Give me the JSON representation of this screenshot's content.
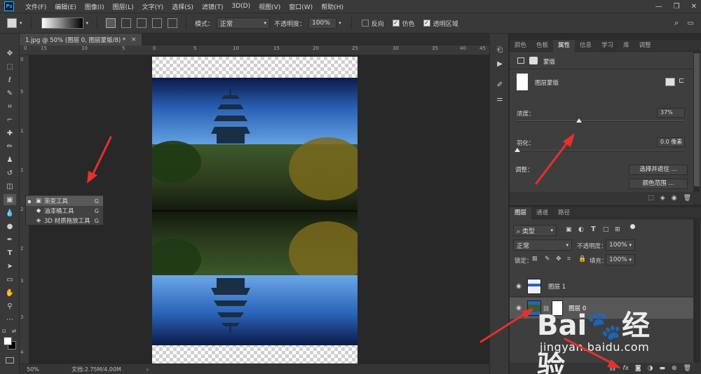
{
  "menubar": {
    "logo": "Ps",
    "items": [
      "文件(F)",
      "编辑(E)",
      "图像(I)",
      "图层(L)",
      "文字(Y)",
      "选择(S)",
      "滤镜(T)",
      "3D(D)",
      "视图(V)",
      "窗口(W)",
      "帮助(H)"
    ],
    "controls": [
      "—",
      "❐",
      "✕"
    ]
  },
  "options": {
    "mode_label": "模式：",
    "mode_value": "正常",
    "opacity_label": "不透明度：",
    "opacity_value": "100%",
    "reverse_label": "反向",
    "dither_label": "仿色",
    "transparency_label": "透明区域"
  },
  "document": {
    "tab_title": "1.jpg @ 50% (图层 0, 图层蒙版/8) *",
    "zoom": "50%",
    "doc_info": "文档:2.75M/4.00M"
  },
  "ruler": {
    "top": [
      "0",
      "15",
      "10",
      "5",
      "0",
      "5",
      "10",
      "15",
      "20",
      "25",
      "30",
      "35",
      "40",
      "45"
    ],
    "left": [
      "0",
      "5",
      "1",
      "1",
      "2",
      "2",
      "3",
      "3",
      "4"
    ]
  },
  "tool_flyout": {
    "items": [
      {
        "icon": "▣",
        "label": "渐变工具",
        "key": "G",
        "active": true
      },
      {
        "icon": "◆",
        "label": "油漆桶工具",
        "key": "G",
        "active": false
      },
      {
        "icon": "◈",
        "label": "3D 材质拖放工具",
        "key": "G",
        "active": false
      }
    ]
  },
  "properties": {
    "tabs": [
      "颜色",
      "色板",
      "属性",
      "信息",
      "学习",
      "库",
      "调整"
    ],
    "active_tab": "属性",
    "header": "蒙版",
    "mask_label": "图层蒙版",
    "density_label": "浓度：",
    "density_value": "37%",
    "density_fraction": 0.37,
    "feather_label": "羽化：",
    "feather_value": "0.0 像素",
    "feather_fraction": 0.0,
    "adjust_label": "调整：",
    "select_mask_button": "选择并遮住 ...",
    "color_range_button": "颜色范围 ..."
  },
  "layers": {
    "tabs": [
      "图层",
      "通道",
      "路径"
    ],
    "active_tab": "图层",
    "kind_filter": "类型",
    "blend_mode": "正常",
    "opacity_label": "不透明度：",
    "opacity_value": "100%",
    "lock_label": "锁定：",
    "fill_label": "填充：",
    "fill_value": "100%",
    "rows": [
      {
        "name": "图层 1",
        "selected": false,
        "has_mask": false
      },
      {
        "name": "图层 0",
        "selected": true,
        "has_mask": true
      }
    ]
  },
  "watermark": {
    "logo": "Bai🐾经验",
    "url": "jingyan.baidu.com"
  }
}
